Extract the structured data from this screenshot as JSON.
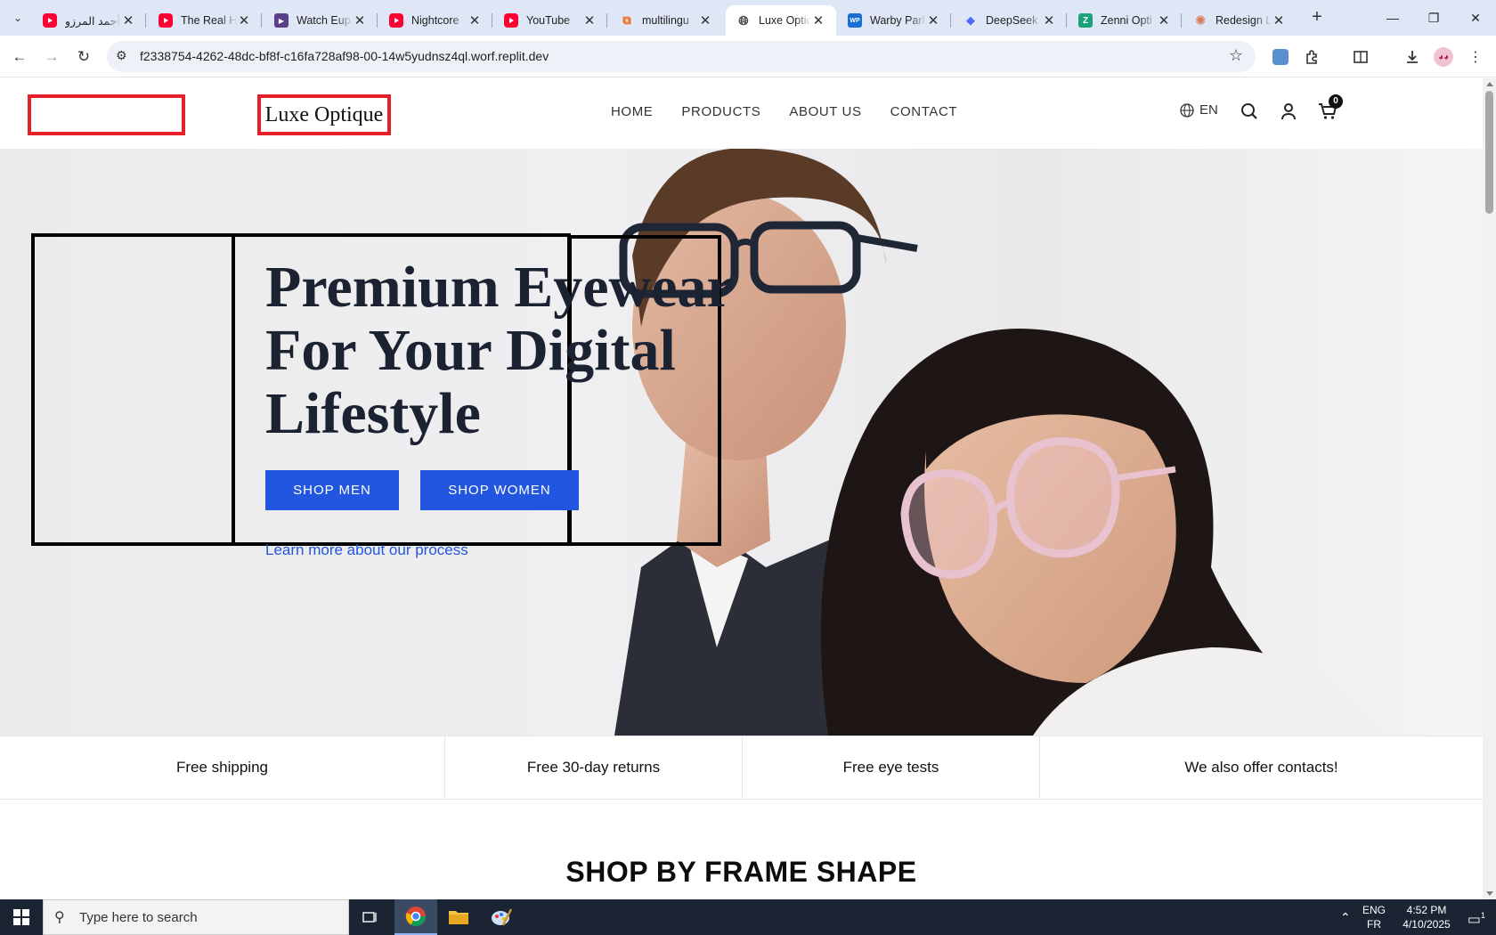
{
  "browser": {
    "tabs": [
      {
        "title": "أحمد المرزو",
        "favicon": "youtube-icon"
      },
      {
        "title": "The Real Hi",
        "favicon": "youtube-icon"
      },
      {
        "title": "Watch Eup",
        "favicon": "film-icon"
      },
      {
        "title": "Nightcore",
        "favicon": "youtube-icon"
      },
      {
        "title": "YouTube",
        "favicon": "youtube-icon"
      },
      {
        "title": "multilingu",
        "favicon": "replit-icon"
      },
      {
        "title": "Luxe Optiq",
        "favicon": "globe-icon",
        "active": true
      },
      {
        "title": "Warby Parl",
        "favicon": "wp-icon"
      },
      {
        "title": "DeepSeek",
        "favicon": "whale-icon"
      },
      {
        "title": "Zenni Opti",
        "favicon": "zenni-icon"
      },
      {
        "title": "Redesign L",
        "favicon": "claude-icon"
      }
    ],
    "url": "f2338754-4262-48dc-bf8f-c16fa728af98-00-14w5yudnsz4ql.worf.replit.dev"
  },
  "site": {
    "brand": "Luxe Optique",
    "nav": [
      "HOME",
      "PRODUCTS",
      "ABOUT US",
      "CONTACT"
    ],
    "language": "EN",
    "cart_count": "0",
    "hero": {
      "title_lines": [
        "Premium Eyewear",
        "For Your Digital",
        "Lifestyle"
      ],
      "button_men": "SHOP MEN",
      "button_women": "SHOP WOMEN",
      "link": "Learn more about our process"
    },
    "perks": [
      "Free shipping",
      "Free 30-day returns",
      "Free eye tests",
      "We also offer contacts!"
    ],
    "section_title": "SHOP BY FRAME SHAPE"
  },
  "taskbar": {
    "search_placeholder": "Type here to search",
    "lang_top": "ENG",
    "lang_bottom": "FR",
    "time": "4:52 PM",
    "date": "4/10/2025",
    "notification_count": "1"
  },
  "colors": {
    "accent": "#2356e0",
    "outline_red": "#e5202a",
    "heading": "#1b2232",
    "taskbar": "#1b2433"
  }
}
